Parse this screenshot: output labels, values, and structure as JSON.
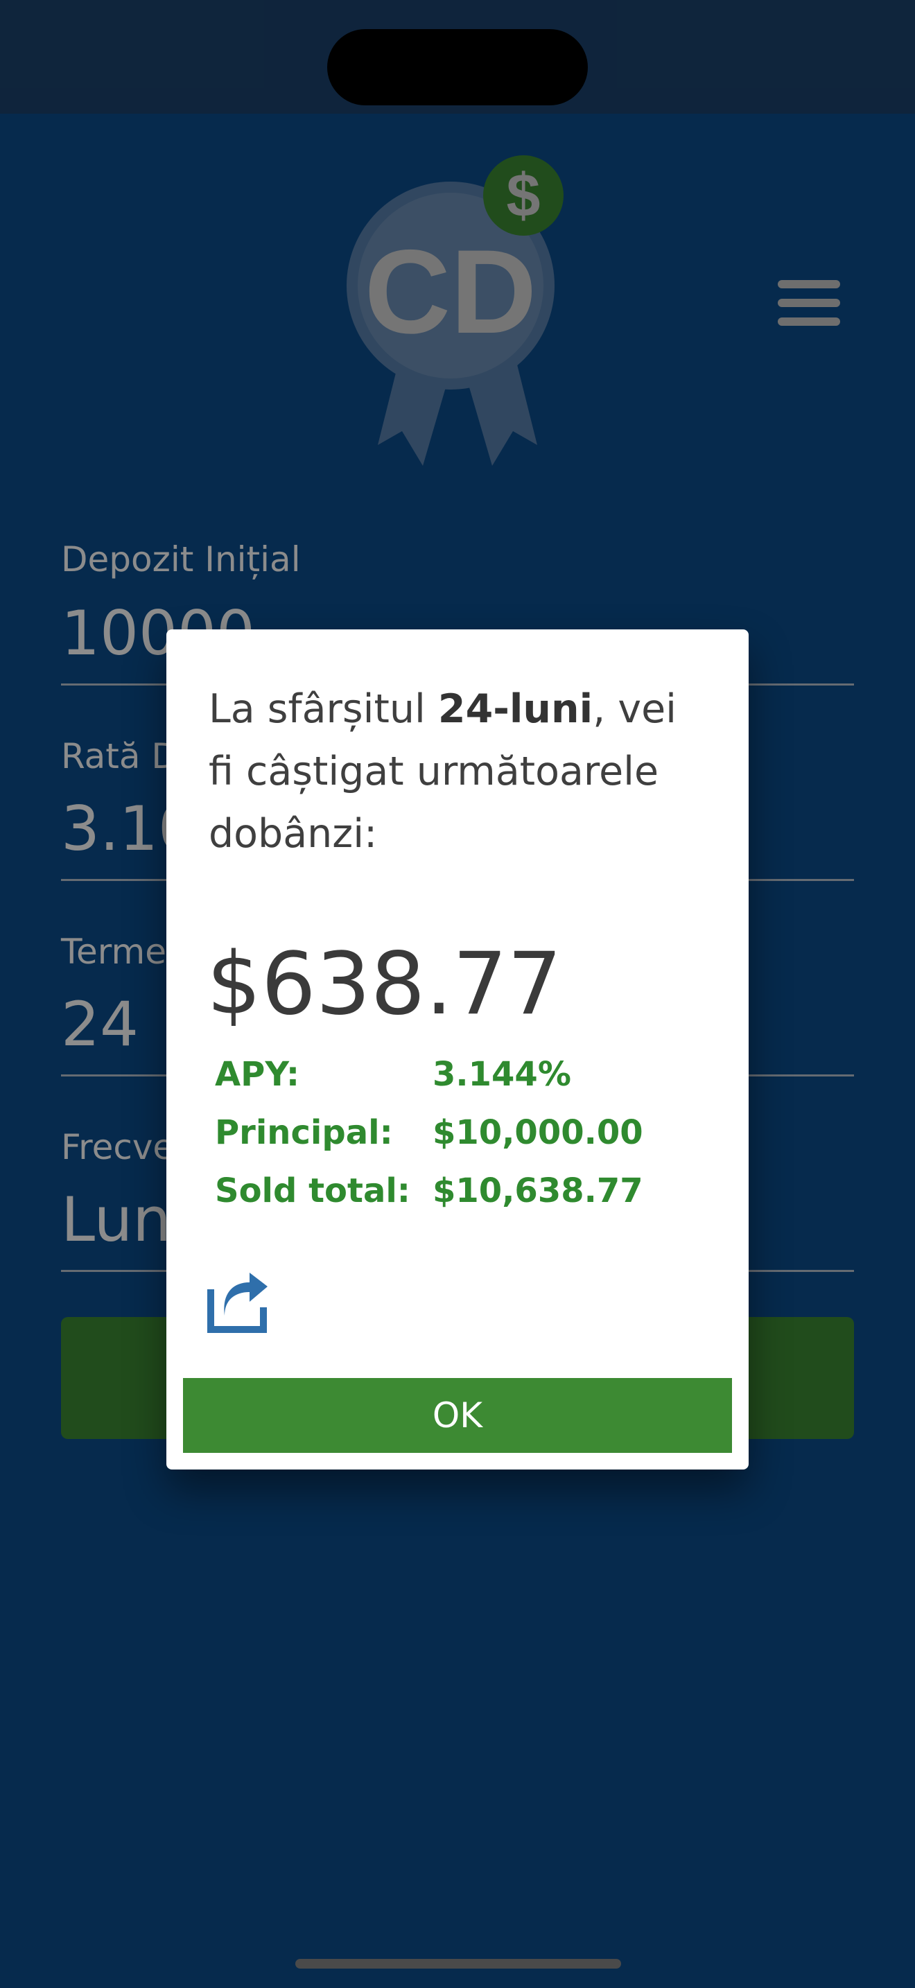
{
  "logo": {
    "text": "CD",
    "badge_symbol": "$"
  },
  "form": {
    "deposit_label": "Depozit Inițial",
    "deposit_value": "10000",
    "rate_label": "Rată Dobândă (%)",
    "rate_value": "3.10",
    "term_label": "Termen (luni)",
    "term_value": "24",
    "frequency_label": "Frecvență Compunere",
    "frequency_value": "Lunar",
    "calculate_label": ""
  },
  "modal": {
    "message_prefix": "La sfârșitul ",
    "message_term": "24-luni",
    "message_suffix": ", vei fi câștigat următoarele dobânzi:",
    "amount": "$638.77",
    "rows": [
      {
        "label": "APY:",
        "value": "3.144%"
      },
      {
        "label": "Principal:",
        "value": "$10,000.00"
      },
      {
        "label": "Sold total:",
        "value": "$10,638.77"
      }
    ],
    "ok_label": "OK"
  },
  "colors": {
    "background": "#0b4d8c",
    "accent_green": "#3d8a33",
    "text_green": "#2f8a2f"
  }
}
